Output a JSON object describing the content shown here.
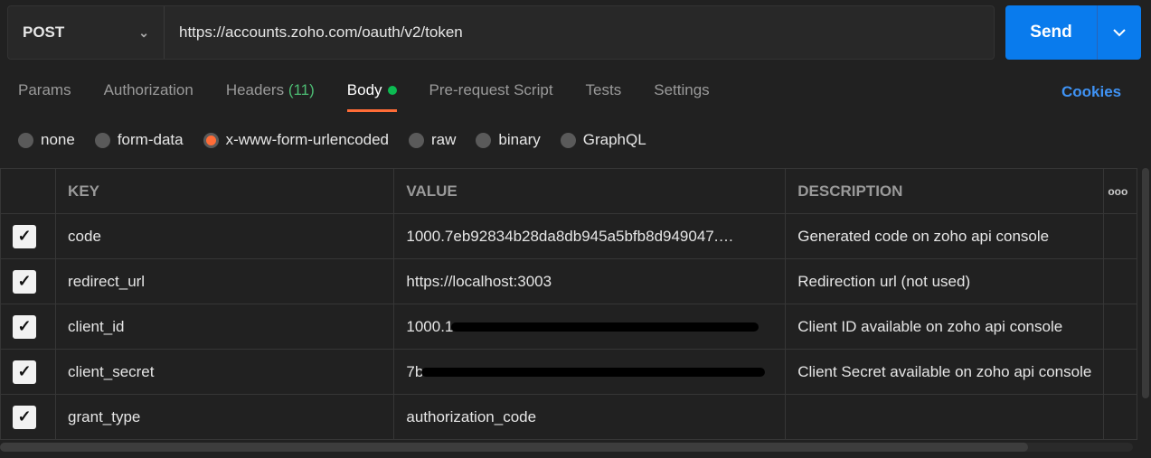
{
  "request": {
    "method": "POST",
    "url": "https://accounts.zoho.com/oauth/v2/token",
    "send_label": "Send"
  },
  "tabs": [
    {
      "label": "Params"
    },
    {
      "label": "Authorization"
    },
    {
      "label": "Headers",
      "count": "(11)"
    },
    {
      "label": "Body"
    },
    {
      "label": "Pre-request Script"
    },
    {
      "label": "Tests"
    },
    {
      "label": "Settings"
    }
  ],
  "cookies_label": "Cookies",
  "body_types": [
    {
      "label": "none"
    },
    {
      "label": "form-data"
    },
    {
      "label": "x-www-form-urlencoded",
      "selected": true
    },
    {
      "label": "raw"
    },
    {
      "label": "binary"
    },
    {
      "label": "GraphQL"
    }
  ],
  "table": {
    "headers": {
      "key": "KEY",
      "value": "VALUE",
      "description": "DESCRIPTION",
      "more": "ooo"
    },
    "rows": [
      {
        "key": "code",
        "value": "1000.7eb92834b28da8db945a5bfb8d949047.…",
        "description": "Generated code on zoho api console",
        "checked": true
      },
      {
        "key": "redirect_url",
        "value": "https://localhost:3003",
        "description": "Redirection url (not used)",
        "checked": true
      },
      {
        "key": "client_id",
        "value": "1000.1",
        "description": "Client ID available on zoho api console",
        "checked": true
      },
      {
        "key": "client_secret",
        "value": "7b",
        "description": "Client Secret available on zoho api console",
        "checked": true
      },
      {
        "key": "grant_type",
        "value": "authorization_code",
        "description": "",
        "checked": true
      }
    ]
  }
}
